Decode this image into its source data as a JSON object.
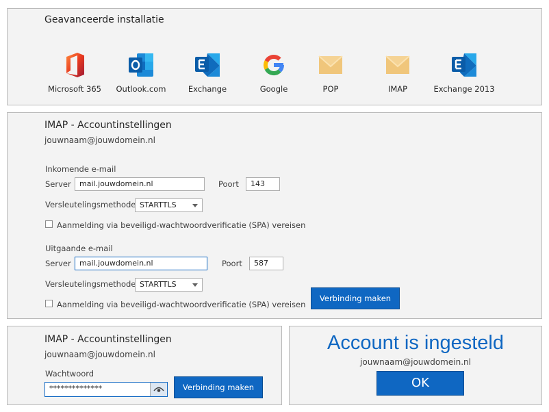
{
  "setup": {
    "title": "Geavanceerde installatie",
    "providers": [
      {
        "label": "Microsoft 365",
        "icon": "microsoft-365-icon"
      },
      {
        "label": "Outlook.com",
        "icon": "outlook-icon"
      },
      {
        "label": "Exchange",
        "icon": "exchange-icon"
      },
      {
        "label": "Google",
        "icon": "google-icon"
      },
      {
        "label": "POP",
        "icon": "envelope-icon"
      },
      {
        "label": "IMAP",
        "icon": "envelope-icon"
      },
      {
        "label": "Exchange 2013",
        "icon": "exchange-icon"
      }
    ]
  },
  "imap_settings": {
    "title": "IMAP - Accountinstellingen",
    "email": "jouwnaam@jouwdomein.nl",
    "incoming": {
      "heading": "Inkomende e-mail",
      "server_label": "Server",
      "server_value": "mail.jouwdomein.nl",
      "port_label": "Poort",
      "port_value": "143",
      "encryption_label": "Versleutelingsmethode",
      "encryption_value": "STARTTLS",
      "spa_label": "Aanmelding via beveiligd-wachtwoordverificatie (SPA) vereisen"
    },
    "outgoing": {
      "heading": "Uitgaande e-mail",
      "server_label": "Server",
      "server_value": "mail.jouwdomein.nl",
      "port_label": "Poort",
      "port_value": "587",
      "encryption_label": "Versleutelingsmethode",
      "encryption_value": "STARTTLS",
      "spa_label": "Aanmelding via beveiligd-wachtwoordverificatie (SPA) vereisen"
    },
    "connect_label": "Verbinding maken"
  },
  "password_panel": {
    "title": "IMAP - Accountinstellingen",
    "email": "jouwnaam@jouwdomein.nl",
    "password_label": "Wachtwoord",
    "password_value": "**************",
    "connect_label": "Verbinding maken"
  },
  "done_panel": {
    "title": "Account is ingesteld",
    "email": "jouwnaam@jouwdomein.nl",
    "ok_label": "OK"
  },
  "colors": {
    "accent": "#0f67c2",
    "panel_bg": "#f3f3f3",
    "panel_border": "#b9b9b9"
  }
}
